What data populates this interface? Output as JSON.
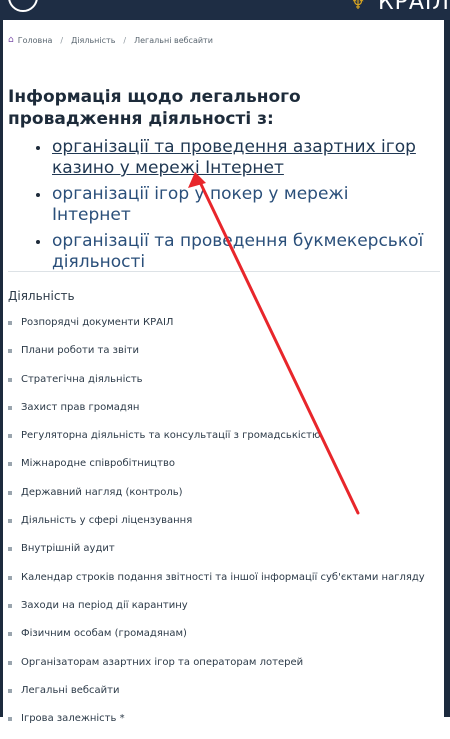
{
  "header": {
    "brand": "КРАІЛ"
  },
  "breadcrumb": [
    "Головна",
    "Діяльність",
    "Легальні вебсайти"
  ],
  "info": {
    "title": "Інформація щодо легального провадження діяльності з:",
    "links": [
      "організації та проведення азартних ігор казино у мережі Інтернет",
      "організації ігор у покер у мережі Інтернет",
      "організації та проведення букмекерської діяльності"
    ]
  },
  "sidebar": {
    "title": "Діяльність",
    "items": [
      "Розпорядчі документи КРАІЛ",
      "Плани роботи та звіти",
      "Стратегічна діяльність",
      "Захист прав громадян",
      "Регуляторна діяльність та консультації з громадськістю",
      "Міжнародне співробітництво",
      "Державний нагляд (контроль)",
      "Діяльність у сфері ліцензування",
      "Внутрішній аудит",
      "Календар строків подання звітності та іншої інформації суб'єктами нагляду",
      "Заходи на період дії карантину",
      "Фізичним особам (громадянам)",
      "Організаторам азартних ігор та операторам лотерей",
      "Легальні вебсайти",
      "Ігрова залежність *"
    ]
  },
  "colors": {
    "header_bg": "#1e2d44",
    "link": "#2a4f7a",
    "arrow": "#e8262b"
  }
}
